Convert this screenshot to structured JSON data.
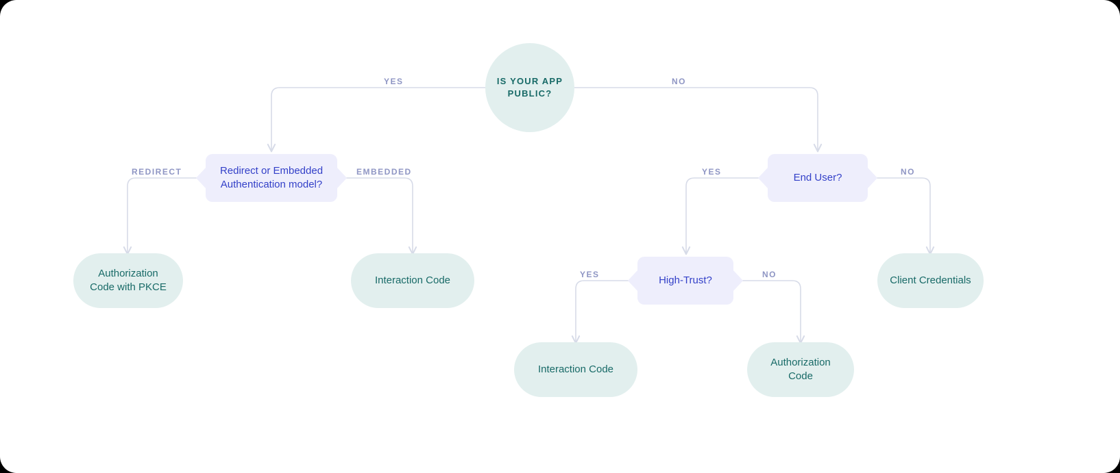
{
  "nodes": {
    "start": {
      "text": "IS YOUR APP PUBLIC?"
    },
    "redirect_embedded": {
      "text": "Redirect or Embedded Authentication model?"
    },
    "end_user": {
      "text": "End User?"
    },
    "high_trust": {
      "text": "High-Trust?"
    },
    "auth_code_pkce": {
      "text": "Authorization Code with PKCE"
    },
    "interaction_code_left": {
      "text": "Interaction Code"
    },
    "interaction_code_right": {
      "text": "Interaction Code"
    },
    "authorization_code": {
      "text": "Authorization Code"
    },
    "client_credentials": {
      "text": "Client Credentials"
    }
  },
  "edges": {
    "start_yes": {
      "label": "YES"
    },
    "start_no": {
      "label": "NO"
    },
    "re_redirect": {
      "label": "REDIRECT"
    },
    "re_embedded": {
      "label": "EMBEDDED"
    },
    "eu_yes": {
      "label": "YES"
    },
    "eu_no": {
      "label": "NO"
    },
    "ht_yes": {
      "label": "YES"
    },
    "ht_no": {
      "label": "NO"
    }
  }
}
